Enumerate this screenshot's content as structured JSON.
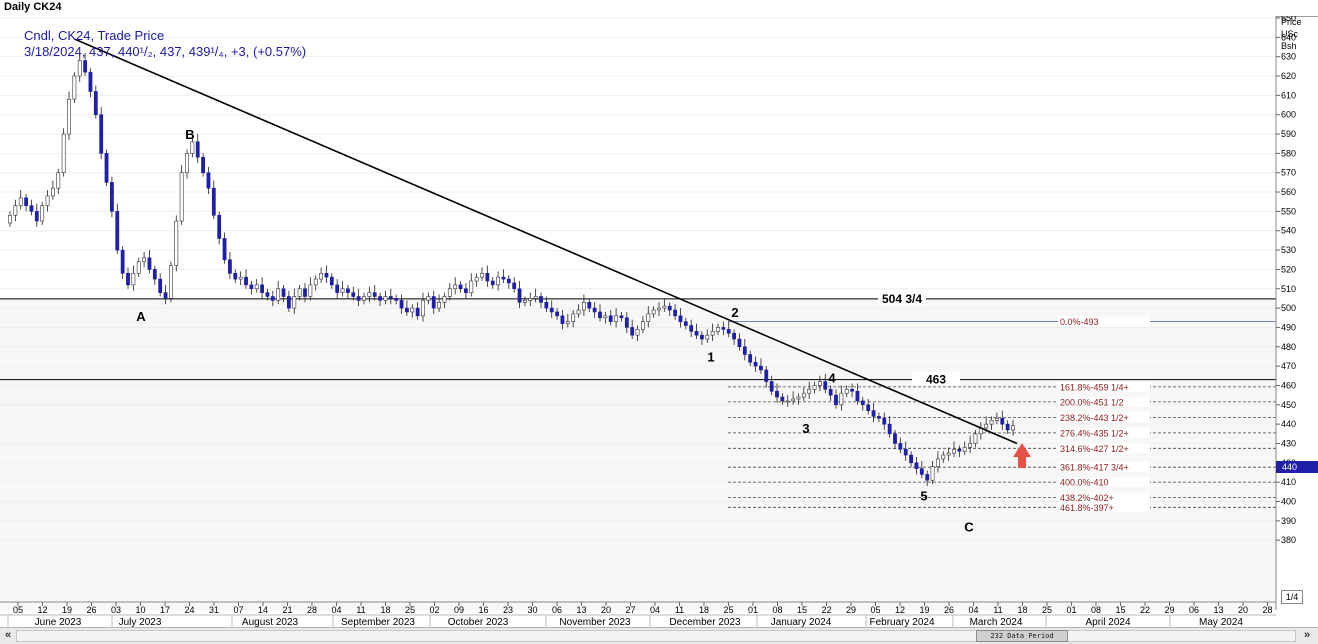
{
  "window_title": "Daily CK24",
  "legend": {
    "line1": "Cndl, CK24, Trade Price",
    "line2": "3/18/2024, 437, 440¹/₂, 437, 439¹/₄, +3, (+0.57%)"
  },
  "axis_header": {
    "line1": "Price",
    "line2": "USc",
    "line3": "Bsh"
  },
  "last_price_tag": "440",
  "fraction_button": "1/4",
  "scroll_label": "232 Data Period",
  "nav": {
    "left": "«",
    "right": "»"
  },
  "colors": {
    "up_candle": "#ffffff",
    "down_candle": "#1f1fa8",
    "fib_text": "#8b1a1a",
    "trendline": "#000000",
    "arrow": "#e8504a",
    "price_tag": "#1f1fa8"
  },
  "chart_data": {
    "type": "candlestick",
    "symbol": "CK24",
    "series_name": "Trade Price",
    "ylim": [
      370,
      660
    ],
    "yticks": [
      380,
      390,
      400,
      410,
      420,
      430,
      440,
      450,
      460,
      470,
      480,
      490,
      500,
      510,
      520,
      530,
      540,
      550,
      560,
      570,
      580,
      590,
      600,
      610,
      620,
      630,
      640,
      650
    ],
    "x_day_ticks": [
      "05",
      "12",
      "19",
      "26",
      "03",
      "10",
      "17",
      "24",
      "31",
      "07",
      "14",
      "21",
      "28",
      "04",
      "11",
      "18",
      "25",
      "02",
      "09",
      "16",
      "23",
      "30",
      "06",
      "13",
      "20",
      "27",
      "04",
      "11",
      "18",
      "25",
      "01",
      "08",
      "15",
      "22",
      "29",
      "05",
      "12",
      "19",
      "26",
      "04",
      "11",
      "18",
      "25",
      "01",
      "08",
      "15",
      "22",
      "29",
      "06",
      "13",
      "20",
      "28"
    ],
    "x_month_labels": [
      "June 2023",
      "July 2023",
      "August 2023",
      "September 2023",
      "October 2023",
      "November 2023",
      "December 2023",
      "January 2024",
      "February 2024",
      "March 2024",
      "April 2024",
      "May 2024"
    ],
    "closes": [
      548,
      553,
      557,
      553,
      550,
      545,
      553,
      558,
      562,
      570,
      590,
      608,
      620,
      628,
      622,
      612,
      600,
      580,
      565,
      550,
      530,
      518,
      512,
      518,
      524,
      526,
      520,
      515,
      508,
      505,
      522,
      545,
      570,
      580,
      586,
      578,
      570,
      562,
      548,
      536,
      525,
      518,
      515,
      516,
      512,
      510,
      512,
      508,
      506,
      504,
      510,
      506,
      500,
      506,
      510,
      506,
      512,
      515,
      518,
      516,
      512,
      508,
      510,
      508,
      506,
      504,
      506,
      508,
      506,
      504,
      506,
      505,
      504,
      500,
      498,
      500,
      496,
      504,
      506,
      500,
      503,
      506,
      510,
      512,
      510,
      508,
      514,
      516,
      518,
      514,
      512,
      516,
      515,
      513,
      510,
      503,
      504,
      505,
      506,
      503,
      500,
      498,
      496,
      492,
      493,
      497,
      499,
      503,
      500,
      498,
      495,
      496,
      493,
      496,
      495,
      490,
      486,
      489,
      493,
      497,
      499,
      500,
      501,
      499,
      496,
      493,
      491,
      488,
      486,
      484,
      486,
      488,
      490,
      489,
      487,
      484,
      480,
      476,
      472,
      470,
      468,
      462,
      457,
      454,
      452,
      452,
      453,
      454,
      456,
      458,
      460,
      462,
      458,
      455,
      450,
      456,
      458,
      457,
      452,
      450,
      447,
      444,
      443,
      440,
      435,
      430,
      427,
      424,
      420,
      417,
      414,
      411,
      418,
      422,
      424,
      425,
      427,
      426,
      428,
      430,
      435,
      438,
      440,
      442,
      443,
      440,
      437,
      439.25
    ],
    "annotations": {
      "horizontal_lines": [
        {
          "value": 504.75,
          "label": "504 3/4"
        },
        {
          "value": 463,
          "label": "463"
        }
      ],
      "trendline": {
        "from": {
          "date": "2023-06-21",
          "price": 639
        },
        "to": {
          "date": "2024-03-19",
          "price": 430
        }
      },
      "wave_labels": [
        {
          "label": "A",
          "date": "2023-07-11",
          "price": 496
        },
        {
          "label": "B",
          "date": "2023-07-25",
          "price": 590
        },
        {
          "label": "1",
          "date": "2023-12-20",
          "price": 475
        },
        {
          "label": "2",
          "date": "2023-12-28",
          "price": 498
        },
        {
          "label": "3",
          "date": "2024-01-17",
          "price": 438
        },
        {
          "label": "4",
          "date": "2024-01-26",
          "price": 464
        },
        {
          "label": "5",
          "date": "2024-02-23",
          "price": 403
        },
        {
          "label": "C",
          "date": "2024-03-06",
          "price": 387
        }
      ],
      "fib_levels": [
        {
          "label": "0.0%-493",
          "value": 493
        },
        {
          "label": "161.8%-459 1/4+",
          "value": 459.25
        },
        {
          "label": "200.0%-451 1/2",
          "value": 451.5
        },
        {
          "label": "238.2%-443 1/2+",
          "value": 443.5
        },
        {
          "label": "276.4%-435 1/2+",
          "value": 435.5
        },
        {
          "label": "314.6%-427 1/2+",
          "value": 427.5
        },
        {
          "label": "361.8%-417 3/4+",
          "value": 417.75
        },
        {
          "label": "400.0%-410",
          "value": 410
        },
        {
          "label": "438.2%-402+",
          "value": 402
        },
        {
          "label": "461.8%-397+",
          "value": 397
        }
      ]
    }
  }
}
